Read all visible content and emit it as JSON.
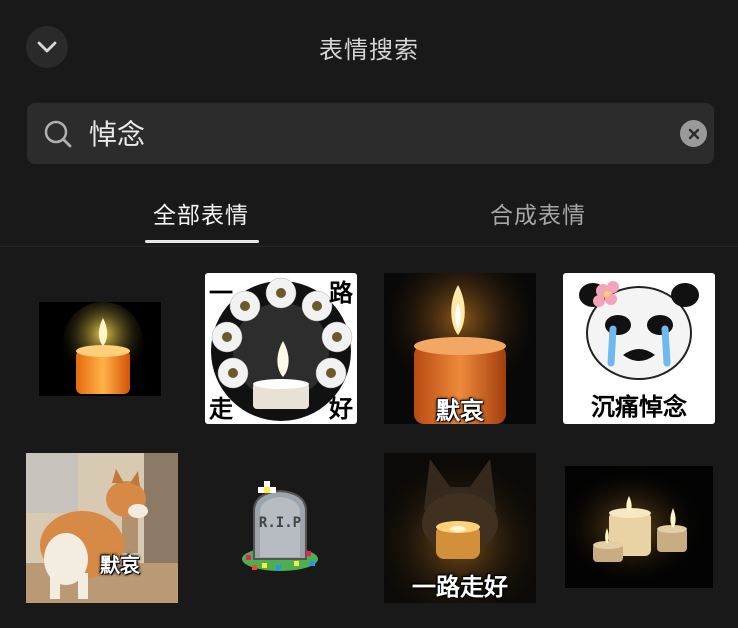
{
  "header": {
    "title": "表情搜索"
  },
  "search": {
    "value": "悼念"
  },
  "tabs": [
    {
      "label": "全部表情",
      "active": true
    },
    {
      "label": "合成表情",
      "active": false
    }
  ],
  "stickers": [
    {
      "name": "candle-orange"
    },
    {
      "name": "flower-wreath-candle",
      "corners": [
        "一",
        "路",
        "走",
        "好"
      ]
    },
    {
      "name": "candle-mourning",
      "caption": "默哀"
    },
    {
      "name": "panda-crying",
      "caption": "沉痛悼念"
    },
    {
      "name": "shiba-dog-bowing",
      "caption": "默哀"
    },
    {
      "name": "rip-tombstone-icon",
      "text": "R.I.P"
    },
    {
      "name": "cat-candle",
      "caption": "一路走好"
    },
    {
      "name": "three-candles"
    }
  ],
  "colors": {
    "background": "#191919",
    "search_bg": "#2c2c2c",
    "active_tab": "#f2f2f2",
    "inactive_tab": "#a6a6a6"
  }
}
